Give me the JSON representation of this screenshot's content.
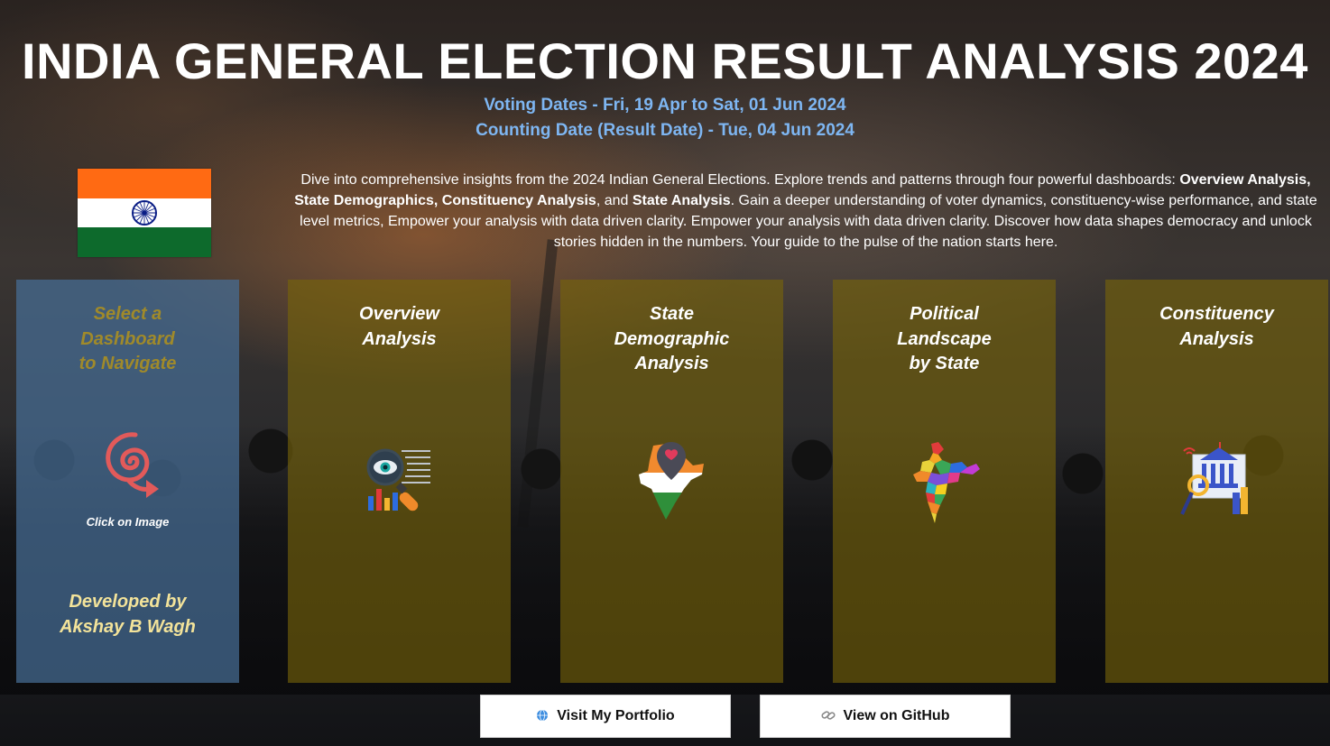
{
  "header": {
    "title": "INDIA GENERAL ELECTION RESULT ANALYSIS 2024",
    "voting_dates": "Voting Dates - Fri, 19 Apr to Sat, 01 Jun 2024",
    "counting_date": "Counting Date (Result Date) - Tue, 04 Jun 2024"
  },
  "description": {
    "p1": "Dive into comprehensive insights from the 2024 Indian General Elections. Explore trends and patterns through four powerful dashboards: ",
    "b1": "Overview Analysis, State Demographics, Constituency Analysis",
    "p2": ", and ",
    "b2": "State Analysis",
    "p3": ". Gain a deeper understanding of voter dynamics, constituency-wise performance, and state level metrics, Empower your analysis with data driven clarity. Empower your analysis with data driven clarity. Discover how data shapes democracy and unlock stories hidden in the numbers. Your guide to the pulse of the nation starts here."
  },
  "nav_panel": {
    "title": "Select a\nDashboard\nto Navigate",
    "click_label": "Click on Image",
    "developer": "Developed by\nAkshay B Wagh",
    "icon": "spiral-arrow-icon"
  },
  "dashboards": [
    {
      "title": "Overview\nAnalysis",
      "icon": "magnifier-chart-icon"
    },
    {
      "title": "State\nDemographic\nAnalysis",
      "icon": "india-map-pin-icon"
    },
    {
      "title": "Political\nLandscape\nby State",
      "icon": "india-states-map-icon"
    },
    {
      "title": "Constituency\nAnalysis",
      "icon": "government-building-icon"
    }
  ],
  "buttons": {
    "portfolio": "Visit My Portfolio",
    "github": "View on GitHub"
  },
  "colors": {
    "subtitle": "#7eb6f2",
    "nav_panel": "#466e96",
    "dashboard_panel": "#786408",
    "flag_saffron": "#ff6a13",
    "flag_green": "#0d6a2c"
  }
}
